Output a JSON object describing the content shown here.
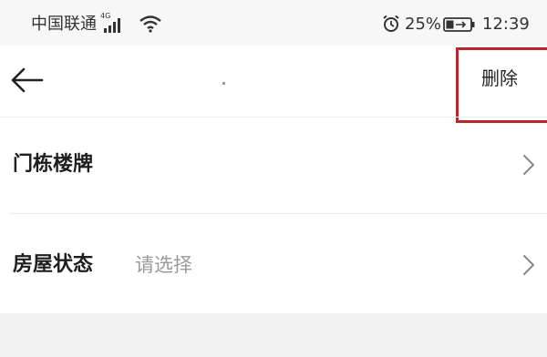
{
  "status_bar": {
    "carrier": "中国联通",
    "network": "4G",
    "battery_percent": "25%",
    "time": "12:39",
    "icons": [
      "signal-icon",
      "wifi-icon",
      "alarm-icon",
      "battery-charging-icon"
    ]
  },
  "nav": {
    "back_icon": "arrow-left-icon",
    "delete_label": "删除",
    "highlight_color": "#b8272e"
  },
  "rows": [
    {
      "label": "门栋楼牌",
      "placeholder": "",
      "icon": "chevron-right-icon"
    },
    {
      "label": "房屋状态",
      "placeholder": "请选择",
      "icon": "chevron-right-icon"
    }
  ]
}
